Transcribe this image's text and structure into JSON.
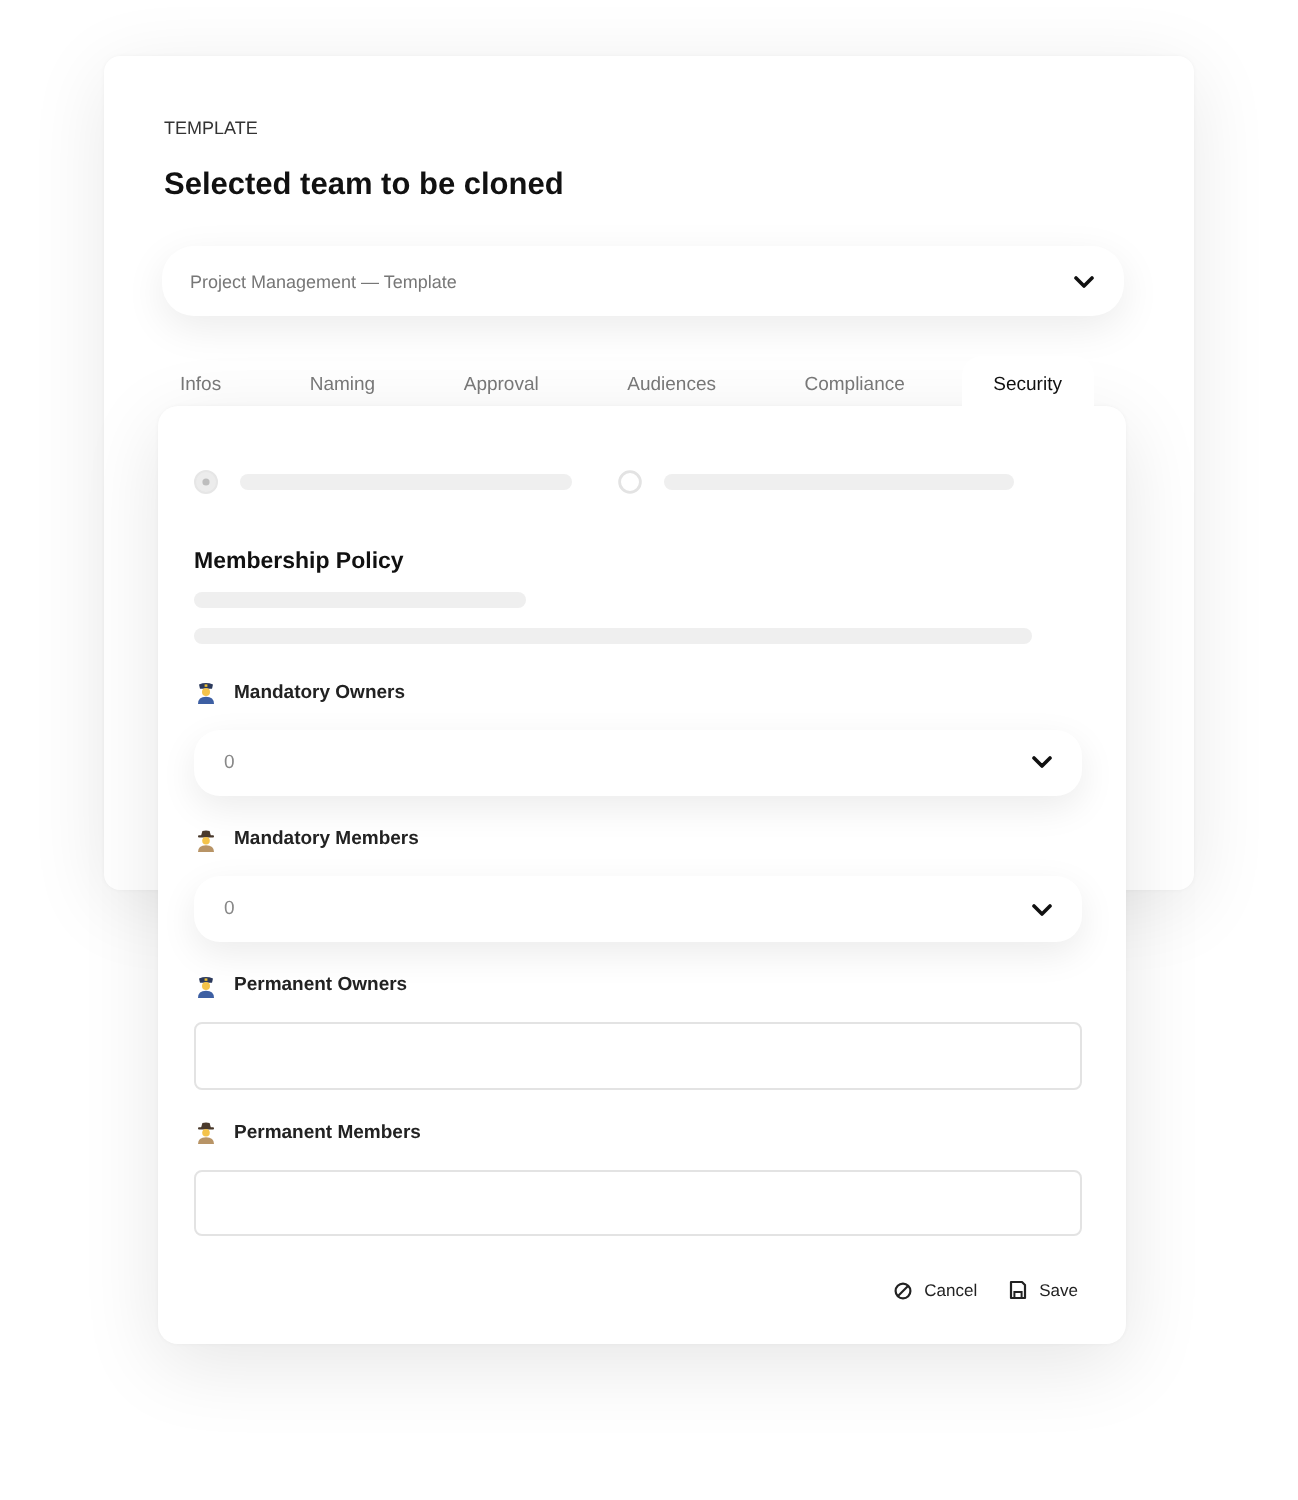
{
  "template_card": {
    "section_label": "TEMPLATE",
    "title": "Selected team to be cloned",
    "template_select": {
      "value": "Project Management — Template"
    }
  },
  "tabs": [
    {
      "label": "Infos",
      "selected": false
    },
    {
      "label": "Naming",
      "selected": false
    },
    {
      "label": "Approval",
      "selected": false
    },
    {
      "label": "Audiences",
      "selected": false
    },
    {
      "label": "Compliance",
      "selected": false
    },
    {
      "label": "Security",
      "selected": true
    }
  ],
  "radio_options": [
    {
      "selected": true
    },
    {
      "selected": false
    }
  ],
  "section_title": "Membership Policy",
  "fields": [
    {
      "label": "Mandatory Owners",
      "kind": "select",
      "value": "0"
    },
    {
      "label": "Mandatory Members",
      "kind": "select",
      "value": "0"
    },
    {
      "label": "Permanent Owners",
      "kind": "input"
    },
    {
      "label": "Permanent Members",
      "kind": "input"
    }
  ],
  "buttons": [
    {
      "label": "Cancel",
      "kind": "cancel"
    },
    {
      "label": "Save",
      "kind": "save"
    }
  ]
}
